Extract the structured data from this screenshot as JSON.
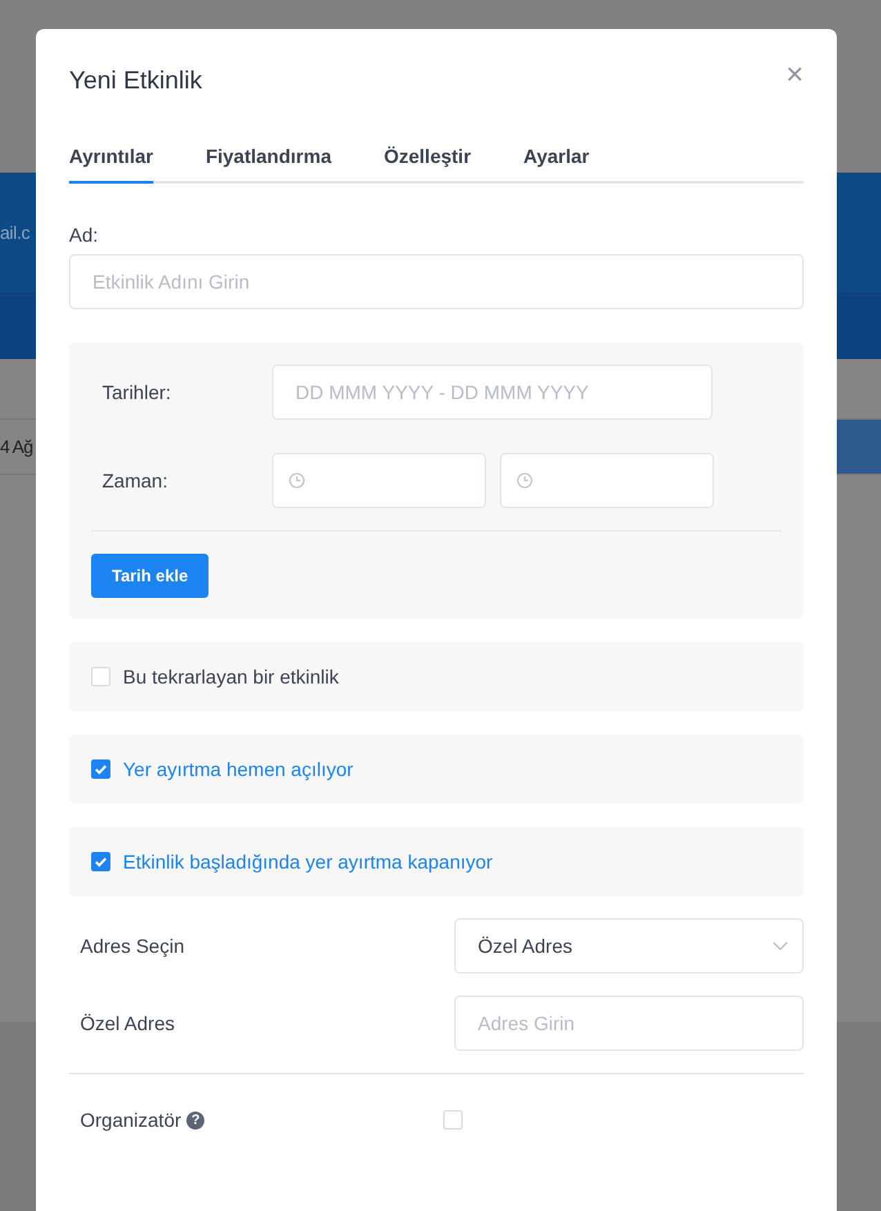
{
  "background": {
    "header_text": "ail.c",
    "row_text": "4 Ağ"
  },
  "dialog": {
    "title": "Yeni Etkinlik",
    "close": "×"
  },
  "tabs": [
    {
      "label": "Ayrıntılar",
      "selected": true
    },
    {
      "label": "Fiyatlandırma",
      "selected": false
    },
    {
      "label": "Özelleştir",
      "selected": false
    },
    {
      "label": "Ayarlar",
      "selected": false
    }
  ],
  "name_field": {
    "label": "Ad:",
    "placeholder": "Etkinlik Adını Girin"
  },
  "dates": {
    "label": "Tarihler:",
    "placeholder": "DD MMM YYYY - DD MMM YYYY"
  },
  "time": {
    "label": "Zaman:"
  },
  "add_date_button": "Tarih ekle",
  "options": [
    {
      "label": "Bu tekrarlayan bir etkinlik",
      "checked": false
    },
    {
      "label": "Yer ayırtma hemen açılıyor",
      "checked": true
    },
    {
      "label": "Etkinlik başladığında yer ayırtma kapanıyor",
      "checked": true
    }
  ],
  "address_select": {
    "label": "Adres Seçin",
    "value": "Özel Adres"
  },
  "custom_address": {
    "label": "Özel Adres",
    "placeholder": "Adres Girin"
  },
  "organizer": {
    "label": "Organizatör",
    "help": "?",
    "checked": false
  }
}
